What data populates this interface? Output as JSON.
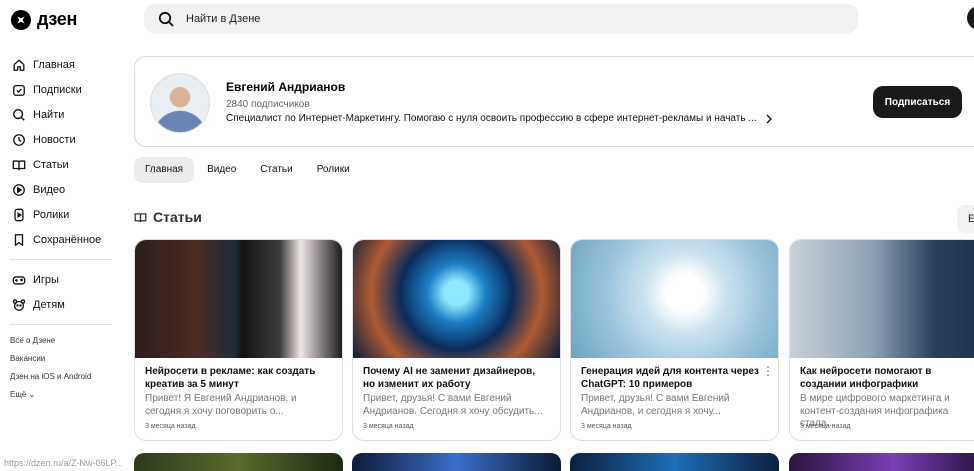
{
  "header": {
    "logo_text": "дзен",
    "search_placeholder": "Найти в Дзене"
  },
  "sidebar": {
    "items": [
      {
        "label": "Главная",
        "icon": "home-icon"
      },
      {
        "label": "Подписки",
        "icon": "subscriptions-icon"
      },
      {
        "label": "Найти",
        "icon": "search-icon"
      },
      {
        "label": "Новости",
        "icon": "news-icon"
      },
      {
        "label": "Статьи",
        "icon": "articles-icon"
      },
      {
        "label": "Видео",
        "icon": "video-icon"
      },
      {
        "label": "Ролики",
        "icon": "shorts-icon"
      },
      {
        "label": "Сохранённое",
        "icon": "bookmark-icon"
      }
    ],
    "extra_items": [
      {
        "label": "Игры",
        "icon": "gamepad-icon"
      },
      {
        "label": "Детям",
        "icon": "kids-icon"
      }
    ],
    "footer_links": [
      "Всё о Дзене",
      "Вакансии",
      "Дзен на iOS и Android",
      "Ещё"
    ]
  },
  "channel": {
    "name": "Евгений Андрианов",
    "subscribers": "2840 подписчиков",
    "description": "Специалист по Интернет-Маркетингу. Помогаю с нуля освоить профессию в сфере интернет-рекламы и начать ...",
    "subscribe_label": "Подписаться"
  },
  "tabs": [
    "Главная",
    "Видео",
    "Статьи",
    "Ролики"
  ],
  "section": {
    "title": "Статьи",
    "more_label": "Е"
  },
  "articles": [
    {
      "title": "Нейросети в рекламе: как создать креатив за 5 минут",
      "snippet": "Привет! Я Евгений Андрианов, и сегодня я хочу поговорить о...",
      "date": "3 месяца назад"
    },
    {
      "title": "Почему AI не заменит дизайнеров, но изменит их работу",
      "snippet": "Привет, друзья! С вами Евгений Андрианов. Сегодня я хочу обсудить...",
      "date": "3 месяца назад"
    },
    {
      "title": "Генерация идей для контента через ChatGPT: 10 примеров",
      "snippet": "Привет, друзья! С вами Евгений Андрианов, и сегодня я хочу...",
      "date": "3 месяца назад"
    },
    {
      "title": "Как нейросети помогают в создании инфографики",
      "snippet": "В мире цифрового маркетинга и контент-создания инфографика стала...",
      "date": "3 месяца назад"
    }
  ],
  "status_url": "https://dzen.ru/a/Z-Nw-06LP..."
}
